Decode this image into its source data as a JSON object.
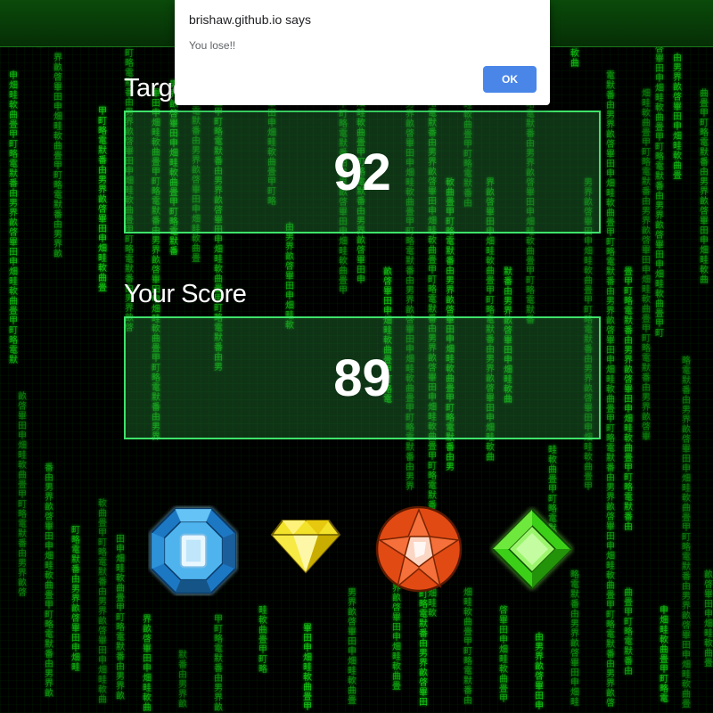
{
  "dialog": {
    "title": "brishaw.github.io says",
    "message": "You lose!!",
    "ok_label": "OK"
  },
  "game": {
    "target_label": "Target Score",
    "target_value": "92",
    "score_label": "Your Score",
    "score_value": "89",
    "gems": [
      {
        "name": "blue-octagon-gem-icon",
        "color": "#2e8fd6"
      },
      {
        "name": "yellow-diamond-gem-icon",
        "color": "#f2e21c"
      },
      {
        "name": "orange-round-gem-icon",
        "color": "#e8521c"
      },
      {
        "name": "green-square-gem-icon",
        "color": "#4fe81c"
      }
    ]
  },
  "theme": {
    "rain_color": "#19d419",
    "box_border": "#3ee36a",
    "dialog_button": "#4a86e8"
  }
}
